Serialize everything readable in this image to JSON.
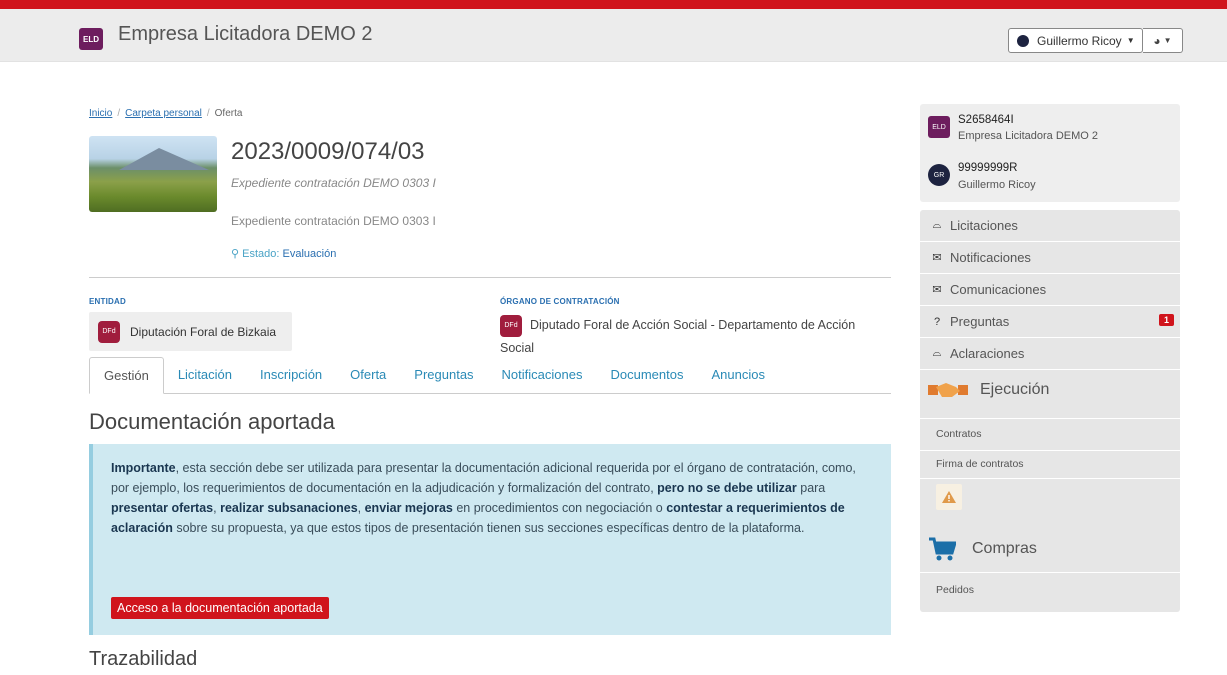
{
  "header": {
    "brand_badge": "ELD",
    "title": "Empresa Licitadora DEMO 2",
    "user_name": "Guillermo Ricoy",
    "accent_color": "#d0141c"
  },
  "breadcrumb": {
    "items": [
      "Inicio",
      "Carpeta personal",
      "Oferta"
    ]
  },
  "expediente": {
    "number": "2023/0009/074/03",
    "subtitle": "Expediente contratación DEMO 0303 I",
    "description": "Expediente contratación DEMO 0303 I",
    "estado_label": "Estado:",
    "estado_value": "Evaluación"
  },
  "entidad": {
    "label": "ENTIDAD",
    "badge": "DFd",
    "name": "Diputación Foral de Bizkaia"
  },
  "organo": {
    "label": "ÓRGANO DE CONTRATACIÓN",
    "badge": "DFd",
    "name": "Diputado Foral de Acción Social - Departamento de Acción Social"
  },
  "tabs": [
    "Gestión",
    "Licitación",
    "Inscripción",
    "Oferta",
    "Preguntas",
    "Notificaciones",
    "Documentos",
    "Anuncios"
  ],
  "section": {
    "title": "Documentación aportada",
    "info_parts": {
      "p1": "Importante",
      "p2": ", esta sección debe ser utilizada para presentar la documentación adicional requerida por el órgano de contratación, como, por ejemplo, los requerimientos de documentación en la adjudicación y formalización del contrato, ",
      "p3": "pero no se debe utilizar",
      "p4": " para ",
      "p5": "presentar ofertas",
      "p6": ", ",
      "p7": "realizar subsanaciones",
      "p8": ", ",
      "p9": "enviar mejoras",
      "p10": " en procedimientos con negociación o ",
      "p11": "contestar a requerimientos de aclaración",
      "p12": " sobre su propuesta, ya que estos tipos de presentación tienen sus secciones específicas dentro de la plataforma."
    },
    "button_label": "Acceso a la documentación aportada",
    "next_title": "Trazabilidad"
  },
  "sidebar": {
    "company": {
      "badge": "ELD",
      "id": "S2658464I",
      "name": "Empresa Licitadora DEMO 2"
    },
    "user": {
      "badge": "GR",
      "id": "99999999R",
      "name": "Guillermo Ricoy"
    },
    "menu": [
      {
        "label": "Licitaciones",
        "icon": "inbox-icon"
      },
      {
        "label": "Notificaciones",
        "icon": "envelope-icon"
      },
      {
        "label": "Comunicaciones",
        "icon": "envelope-icon"
      },
      {
        "label": "Preguntas",
        "icon": "question-icon",
        "badge": "1"
      },
      {
        "label": "Aclaraciones",
        "icon": "inbox-icon"
      }
    ],
    "ejecucion": {
      "title": "Ejecución",
      "links": [
        "Contratos",
        "Firma de contratos"
      ]
    },
    "compras": {
      "title": "Compras",
      "links": [
        "Pedidos"
      ]
    }
  }
}
